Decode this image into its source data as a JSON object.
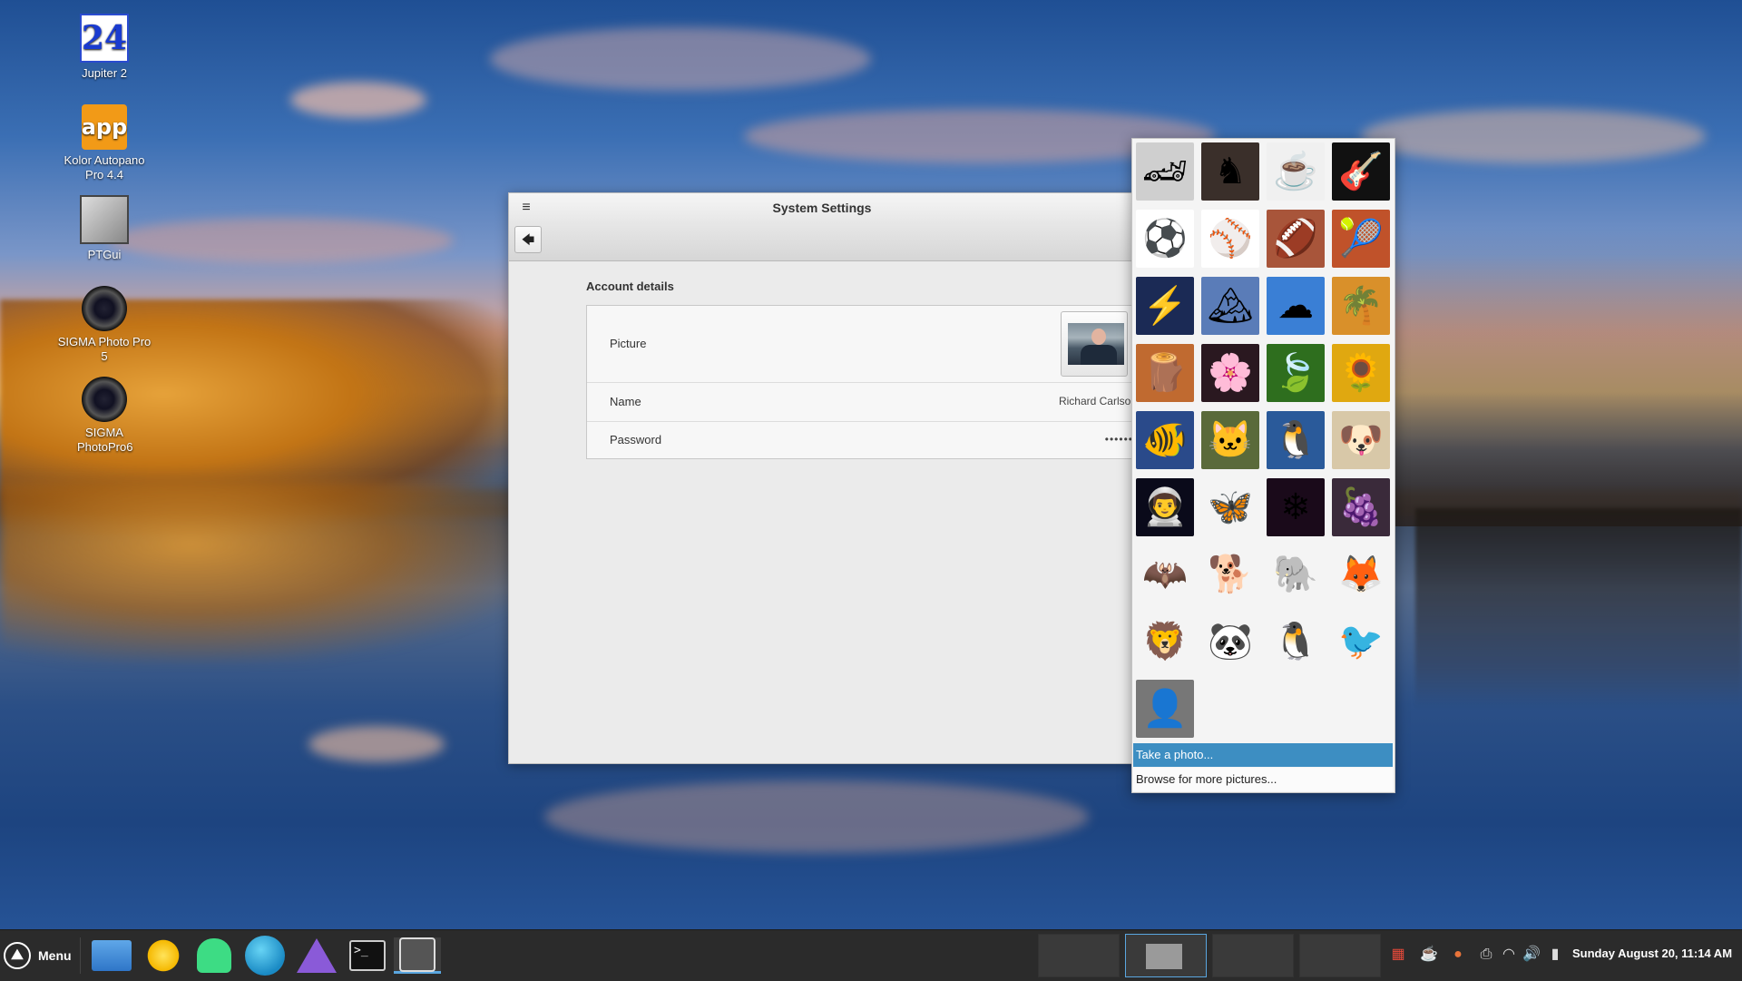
{
  "desktop": {
    "icons": [
      {
        "label": "Jupiter 2",
        "glyph": "24"
      },
      {
        "label": "Kolor Autopano Pro 4.4",
        "glyph": "app"
      },
      {
        "label": "PTGui",
        "glyph": ""
      },
      {
        "label": "SIGMA Photo Pro 5",
        "glyph": ""
      },
      {
        "label": "SIGMA PhotoPro6",
        "glyph": ""
      }
    ]
  },
  "window": {
    "title": "System Settings",
    "menu_glyph": "≡",
    "back_glyph": "🡄",
    "section_title": "Account details",
    "rows": {
      "picture_label": "Picture",
      "name_label": "Name",
      "name_value": "Richard Carlson",
      "password_label": "Password",
      "password_value": "••••••"
    }
  },
  "popover": {
    "tiles": [
      {
        "name": "race-car-icon",
        "glyph": "🏎"
      },
      {
        "name": "chess-icon",
        "glyph": "♞"
      },
      {
        "name": "coffee-icon",
        "glyph": "☕"
      },
      {
        "name": "guitar-icon",
        "glyph": "🎸"
      },
      {
        "name": "soccer-ball-icon",
        "glyph": "⚽"
      },
      {
        "name": "baseball-icon",
        "glyph": "⚾"
      },
      {
        "name": "football-icon",
        "glyph": "🏈"
      },
      {
        "name": "tennis-icon",
        "glyph": "🎾"
      },
      {
        "name": "lightning-icon",
        "glyph": "⚡"
      },
      {
        "name": "mountain-icon",
        "glyph": "🏔"
      },
      {
        "name": "sky-icon",
        "glyph": "☁"
      },
      {
        "name": "palm-sunset-icon",
        "glyph": "🌴"
      },
      {
        "name": "cinnamon-icon",
        "glyph": "🪵"
      },
      {
        "name": "flower-icon",
        "glyph": "🌸"
      },
      {
        "name": "leaf-icon",
        "glyph": "🍃"
      },
      {
        "name": "sunflower-icon",
        "glyph": "🌻"
      },
      {
        "name": "clownfish-icon",
        "glyph": "🐠"
      },
      {
        "name": "kitten-icon",
        "glyph": "🐱"
      },
      {
        "name": "penguin-photo-icon",
        "glyph": "🐧"
      },
      {
        "name": "puppy-icon",
        "glyph": "🐶"
      },
      {
        "name": "astronaut-icon",
        "glyph": "👨‍🚀"
      },
      {
        "name": "butterfly-icon",
        "glyph": "🦋"
      },
      {
        "name": "snowflake-icon",
        "glyph": "❄"
      },
      {
        "name": "grapes-icon",
        "glyph": "🍇"
      },
      {
        "name": "bat-icon",
        "glyph": "🦇"
      },
      {
        "name": "pug-icon",
        "glyph": "🐕"
      },
      {
        "name": "elephant-icon",
        "glyph": "🐘"
      },
      {
        "name": "fox-icon",
        "glyph": "🦊"
      },
      {
        "name": "lion-icon",
        "glyph": "🦁"
      },
      {
        "name": "panda-icon",
        "glyph": "🐼"
      },
      {
        "name": "penguin-cartoon-icon",
        "glyph": "🐧"
      },
      {
        "name": "toucan-icon",
        "glyph": "🐦"
      },
      {
        "name": "default-user-icon",
        "glyph": "👤"
      }
    ],
    "take_photo": "Take a photo...",
    "browse": "Browse for more pictures..."
  },
  "taskbar": {
    "menu_label": "Menu",
    "menu_glyph": "⛰",
    "terminal_glyph": ">_",
    "clock": "Sunday August 20, 11:14 AM",
    "tray": [
      {
        "name": "calendar-tray-icon",
        "glyph": "▦"
      },
      {
        "name": "coffee-tray-icon",
        "glyph": "☕"
      },
      {
        "name": "notifications-tray-icon",
        "glyph": "●"
      },
      {
        "name": "printer-tray-icon",
        "glyph": "⎙"
      },
      {
        "name": "wifi-tray-icon",
        "glyph": "◠"
      },
      {
        "name": "volume-tray-icon",
        "glyph": "🔊"
      },
      {
        "name": "battery-tray-icon",
        "glyph": "▮"
      }
    ]
  }
}
